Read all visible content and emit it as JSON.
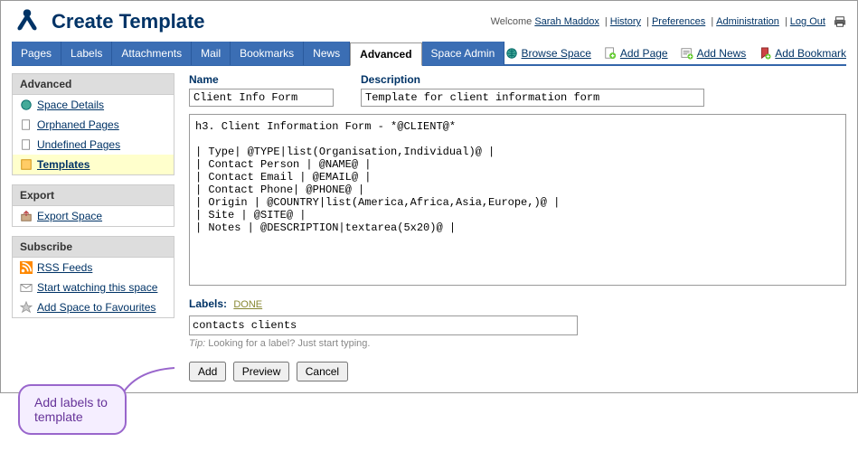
{
  "header": {
    "title": "Create Template",
    "welcome_prefix": "Welcome ",
    "user": "Sarah Maddox",
    "links": [
      "History",
      "Preferences",
      "Administration",
      "Log Out"
    ]
  },
  "tabs": [
    "Pages",
    "Labels",
    "Attachments",
    "Mail",
    "Bookmarks",
    "News",
    "Advanced",
    "Space Admin"
  ],
  "active_tab": "Advanced",
  "actions": {
    "browse": "Browse Space",
    "add_page": "Add Page",
    "add_news": "Add News",
    "add_bookmark": "Add Bookmark"
  },
  "sidebar": {
    "advanced": {
      "title": "Advanced",
      "items": [
        "Space Details",
        "Orphaned Pages",
        "Undefined Pages",
        "Templates"
      ],
      "active": "Templates"
    },
    "export": {
      "title": "Export",
      "items": [
        "Export Space"
      ]
    },
    "subscribe": {
      "title": "Subscribe",
      "items": [
        "RSS Feeds",
        "Start watching this space",
        "Add Space to Favourites"
      ]
    }
  },
  "form": {
    "name_label": "Name",
    "name_value": "Client Info Form",
    "desc_label": "Description",
    "desc_value": "Template for client information form",
    "body": "h3. Client Information Form - *@CLIENT@*\n\n| Type| @TYPE|list(Organisation,Individual)@ |\n| Contact Person | @NAME@ |\n| Contact Email | @EMAIL@ |\n| Contact Phone| @PHONE@ |\n| Origin | @COUNTRY|list(America,Africa,Asia,Europe,)@ |\n| Site | @SITE@ |\n| Notes | @DESCRIPTION|textarea(5x20)@ |",
    "labels_title": "Labels:",
    "labels_done": "DONE",
    "labels_value": "contacts clients",
    "tip_prefix": "Tip:",
    "tip_text": " Looking for a label? Just start typing.",
    "buttons": {
      "add": "Add",
      "preview": "Preview",
      "cancel": "Cancel"
    }
  },
  "callout": "Add labels to template"
}
